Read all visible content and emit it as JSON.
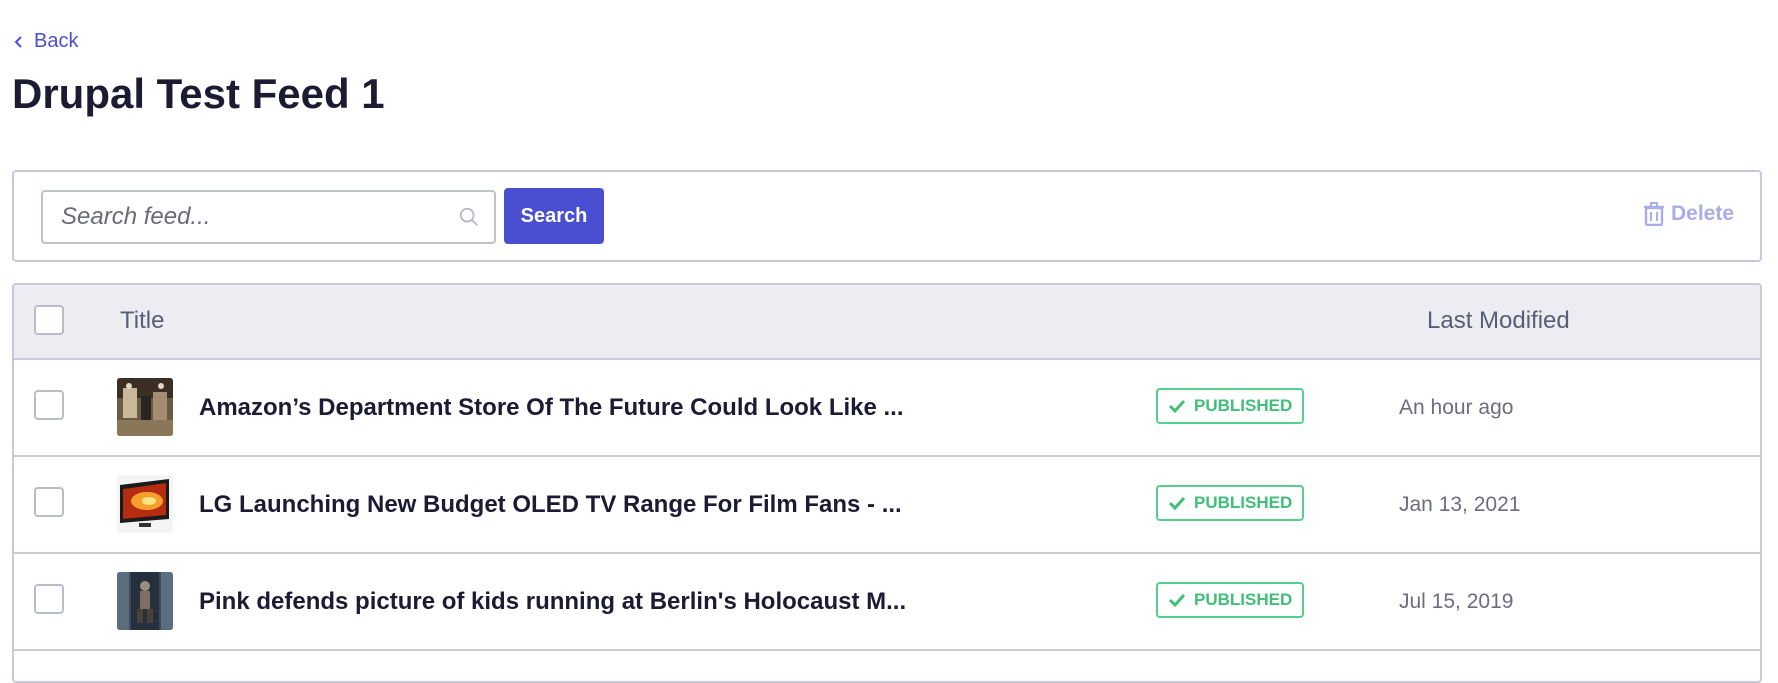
{
  "nav": {
    "back_label": "Back"
  },
  "page": {
    "title": "Drupal Test Feed 1"
  },
  "toolbar": {
    "search_placeholder": "Search feed...",
    "search_button": "Search",
    "delete_label": "Delete"
  },
  "table": {
    "columns": {
      "title": "Title",
      "last_modified": "Last Modified"
    },
    "rows": [
      {
        "title": "Amazon’s Department Store Of The Future Could Look Like ...",
        "status": "PUBLISHED",
        "modified": "An hour ago"
      },
      {
        "title": "LG Launching New Budget OLED TV Range For Film Fans - ...",
        "status": "PUBLISHED",
        "modified": "Jan 13, 2021"
      },
      {
        "title": "Pink defends picture of kids running at Berlin's Holocaust M...",
        "status": "PUBLISHED",
        "modified": "Jul 15, 2019"
      }
    ]
  },
  "colors": {
    "accent": "#4a4fd1",
    "status_published": "#3fbf78",
    "delete_disabled": "#a9ade8"
  }
}
